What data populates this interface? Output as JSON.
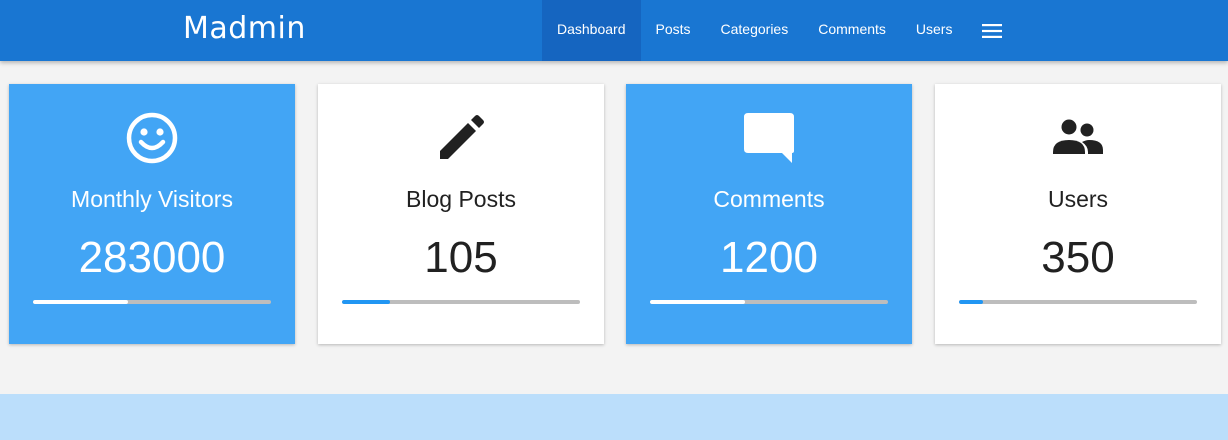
{
  "app": {
    "title": "Madmin"
  },
  "nav": {
    "items": [
      {
        "label": "Dashboard",
        "active": true
      },
      {
        "label": "Posts",
        "active": false
      },
      {
        "label": "Categories",
        "active": false
      },
      {
        "label": "Comments",
        "active": false
      },
      {
        "label": "Users",
        "active": false
      }
    ],
    "menu_icon": "hamburger-menu-icon"
  },
  "stats": [
    {
      "title": "Monthly Visitors",
      "value": "283000",
      "icon": "smiley-face-icon",
      "theme": "blue",
      "progress": 0.4
    },
    {
      "title": "Blog Posts",
      "value": "105",
      "icon": "pencil-icon",
      "theme": "white",
      "progress": 0.2
    },
    {
      "title": "Comments",
      "value": "1200",
      "icon": "comment-icon",
      "theme": "blue",
      "progress": 0.4
    },
    {
      "title": "Users",
      "value": "350",
      "icon": "people-icon",
      "theme": "white",
      "progress": 0.1
    }
  ],
  "colors": {
    "topbar": "#1976d2",
    "nav_active": "#1565c0",
    "card_blue": "#42a5f5",
    "progress_track": "#bdbdbd",
    "progress_accent": "#2196f3",
    "footer_band": "#bbdefb"
  }
}
